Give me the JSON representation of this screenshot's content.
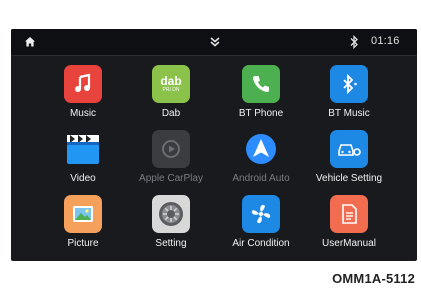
{
  "statusbar": {
    "time": "01:16",
    "home_icon": "home-icon",
    "chevron_icon": "chevron-double-down-icon",
    "bt_icon": "bluetooth-icon"
  },
  "apps": [
    {
      "label": "Music",
      "icon": "music-note-icon",
      "color": "#e8443d",
      "enabled": true
    },
    {
      "label": "Dab",
      "icon": "dab-radio-icon",
      "color": "#8bc34a",
      "enabled": true,
      "icon_text": "dab",
      "icon_subtext": "PRI DN"
    },
    {
      "label": "BT Phone",
      "icon": "phone-icon",
      "color": "#4caf50",
      "enabled": true
    },
    {
      "label": "BT Music",
      "icon": "bluetooth-music-icon",
      "color": "#1e88e5",
      "enabled": true
    },
    {
      "label": "Video",
      "icon": "clapperboard-icon",
      "color": "#2196f3",
      "enabled": true
    },
    {
      "label": "Apple CarPlay",
      "icon": "carplay-icon",
      "color": "#3a3c40",
      "enabled": false
    },
    {
      "label": "Android Auto",
      "icon": "android-auto-icon",
      "color": "#2d8cff",
      "enabled": false
    },
    {
      "label": "Vehicle Setting",
      "icon": "vehicle-setting-icon",
      "color": "#1e88e5",
      "enabled": true
    },
    {
      "label": "Picture",
      "icon": "picture-icon",
      "color": "#f5a15b",
      "enabled": true
    },
    {
      "label": "Setting",
      "icon": "gear-icon",
      "color": "#9e9e9e",
      "enabled": true
    },
    {
      "label": "Air Condition",
      "icon": "fan-icon",
      "color": "#1e88e5",
      "enabled": true
    },
    {
      "label": "UserManual",
      "icon": "document-icon",
      "color": "#f26c4f",
      "enabled": true
    }
  ],
  "caption": "OMM1A-5112"
}
